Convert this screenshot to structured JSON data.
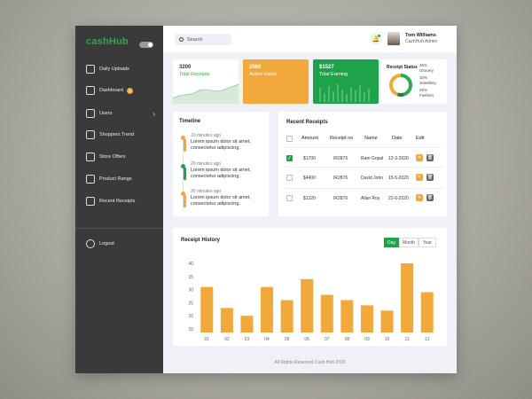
{
  "sidebar": {
    "logo": "cashHub",
    "items": [
      {
        "label": "Daily Uploads",
        "icon": "bar-chart-icon"
      },
      {
        "label": "Dashboard",
        "icon": "inbox-icon",
        "badge": "2"
      },
      {
        "label": "Users",
        "icon": "user-icon"
      },
      {
        "label": "Shoppers Trend",
        "icon": "badge-icon"
      },
      {
        "label": "Store Offers",
        "icon": "bulb-icon"
      },
      {
        "label": "Product Range",
        "icon": "calendar-icon"
      },
      {
        "label": "Recent Receipts",
        "icon": "receipt-icon"
      }
    ],
    "logout": "Logout"
  },
  "topbar": {
    "search_placeholder": "Search",
    "user_name": "Tom Williams",
    "user_role": "CashHub Admin"
  },
  "stats": [
    {
      "value": "3200",
      "label": "Total Receipts"
    },
    {
      "value": "2500",
      "label": "Active Users"
    },
    {
      "value": "$1527",
      "label": "Total Earning"
    }
  ],
  "receipt_status": {
    "title": "Receipt Status",
    "segments": [
      {
        "pct": "45%",
        "name": "Grocery",
        "color": "#2fa84f",
        "share": 0.45
      },
      {
        "pct": "10%",
        "name": "Jewellery",
        "color": "#1c7a3a",
        "share": 0.1
      },
      {
        "pct": "45%",
        "name": "Fashion",
        "color": "#f2a93b",
        "share": 0.45
      }
    ]
  },
  "timeline": {
    "title": "Timeline",
    "items": [
      {
        "time": "10 minutes ago",
        "text": "Lorem ipsum dolor sit amet, consectetur adipiscing."
      },
      {
        "time": "20 minutes ago",
        "text": "Lorem ipsum dolor sit amet, consectetur adipiscing."
      },
      {
        "time": "30 minutes ago",
        "text": "Lorem ipsum dolor sit amet, consectetur adipiscing."
      }
    ]
  },
  "receipts": {
    "title": "Recent Receipts",
    "headers": [
      "Amount",
      "Receipt no",
      "Name",
      "Date",
      "Edit"
    ],
    "rows": [
      {
        "checked": true,
        "amount": "$1700",
        "no": "IR2876",
        "name": "Ram Gopal",
        "date": "12-3-2020"
      },
      {
        "checked": false,
        "amount": "$4400",
        "no": "IR2876",
        "name": "David John",
        "date": "15-5-2020"
      },
      {
        "checked": false,
        "amount": "$1320",
        "no": "IR2876",
        "name": "Allan Roy",
        "date": "22-6-2020"
      }
    ]
  },
  "history": {
    "title": "Receipt History",
    "tabs": [
      "Day",
      "Month",
      "Year"
    ],
    "active_tab": "Day"
  },
  "chart_data": {
    "type": "bar",
    "categories": [
      "01",
      "02",
      "03",
      "04",
      "05",
      "06",
      "07",
      "08",
      "09",
      "10",
      "11",
      "12"
    ],
    "values": [
      31,
      23,
      20,
      31,
      26,
      34,
      28,
      26,
      24,
      22,
      40,
      29
    ],
    "yticks": [
      15,
      20,
      25,
      30,
      35,
      40
    ],
    "ylim": [
      15,
      40
    ],
    "color": "#f2a93b"
  },
  "footer": "All Rights Reserved Cash Hub 2020"
}
